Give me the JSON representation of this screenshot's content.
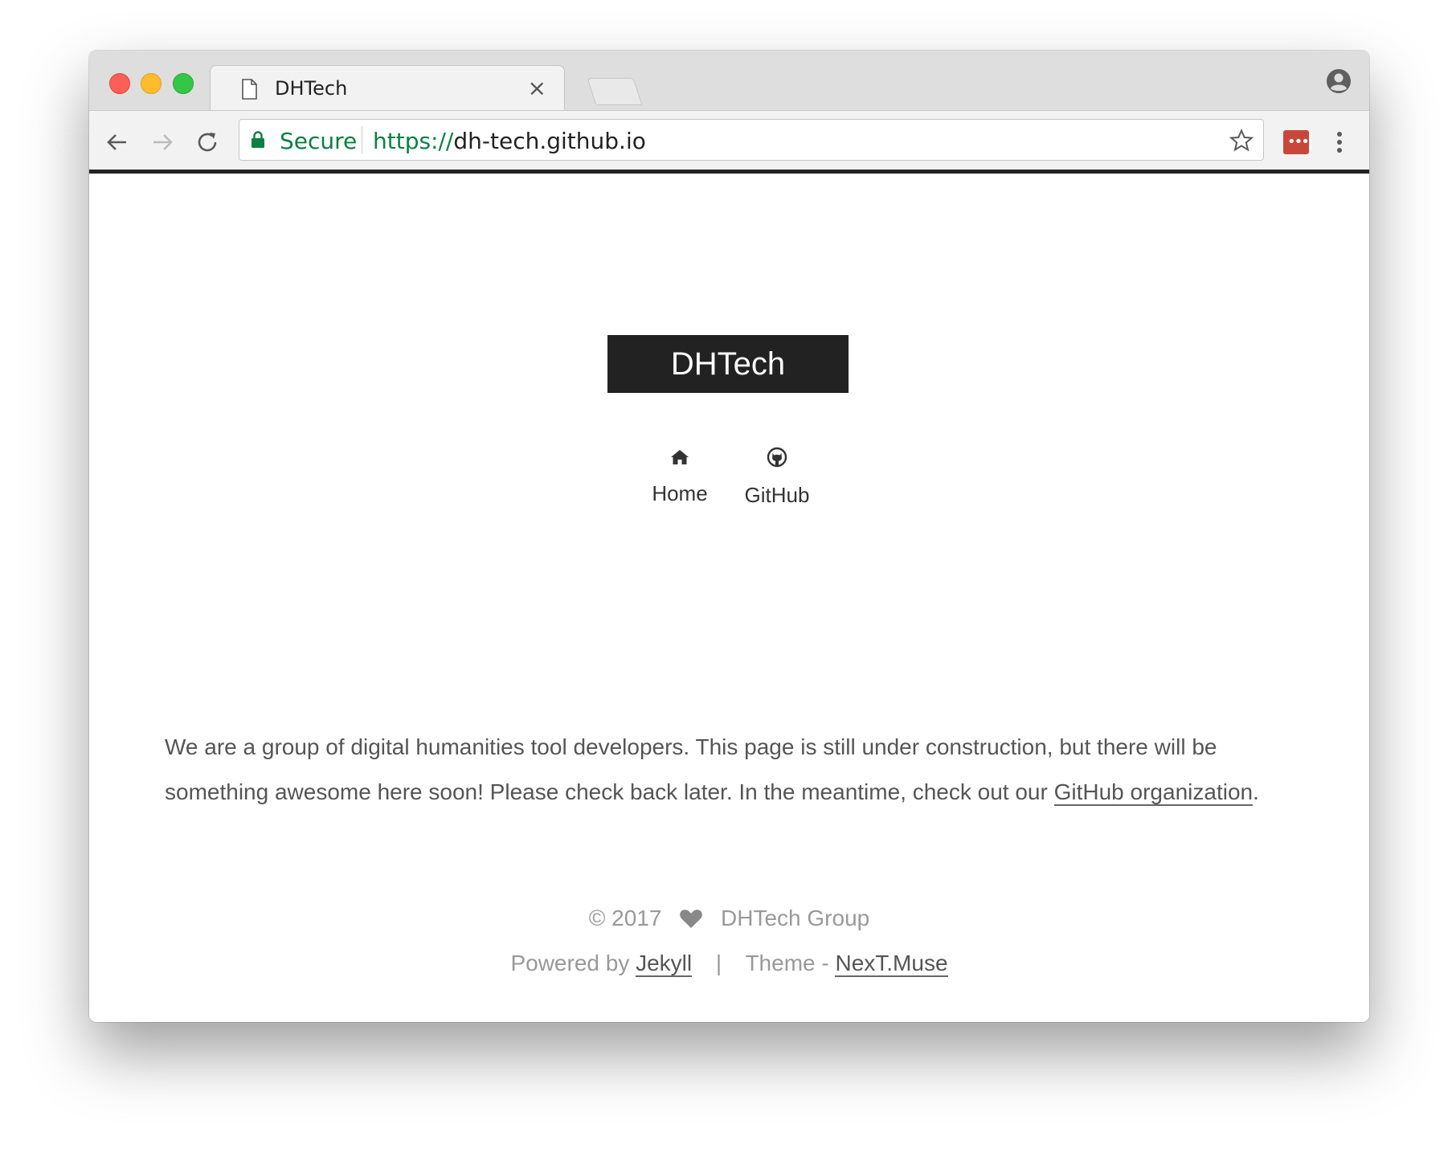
{
  "browser": {
    "tab_title": "DHTech",
    "tab_close": "×",
    "secure_label": "Secure",
    "url_scheme": "https://",
    "url_host": "dh-tech.github.io",
    "extension_label": "•••|"
  },
  "site": {
    "brand": "DHTech",
    "menu": [
      {
        "label": "Home",
        "icon": "home-icon"
      },
      {
        "label": "GitHub",
        "icon": "github-icon"
      }
    ]
  },
  "post": {
    "text_before": "We are a group of digital humanities tool developers. This page is still under construction, but there will be something awesome here soon! Please check back later. In the meantime, check out our ",
    "link_text": "GitHub organization",
    "text_after": "."
  },
  "footer": {
    "copyright": "© 2017",
    "owner": "DHTech Group",
    "powered_prefix": "Powered by ",
    "powered_link": "Jekyll",
    "separator": "|",
    "theme_prefix": "Theme - ",
    "theme_link": "NexT.Muse"
  },
  "colors": {
    "brand_bg": "#222222",
    "secure_green": "#0b8043",
    "footer_text": "#999999",
    "body_text": "#555555"
  }
}
